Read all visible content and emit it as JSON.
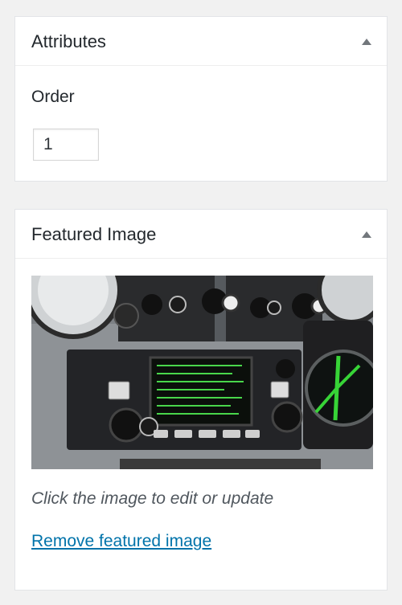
{
  "attributes_box": {
    "title": "Attributes",
    "toggle_icon": "triangle-up-icon",
    "order_label": "Order",
    "order_value": "1"
  },
  "featured_image_box": {
    "title": "Featured Image",
    "toggle_icon": "triangle-up-icon",
    "image_description": "aircraft avionics panel photo",
    "hint": "Click the image to edit or update",
    "remove_link": "Remove featured image"
  },
  "colors": {
    "background": "#f1f1f1",
    "panel": "#ffffff",
    "link": "#0073aa",
    "text": "#23282d",
    "muted_text": "#50575e",
    "screen_text": "#4cff4c"
  }
}
